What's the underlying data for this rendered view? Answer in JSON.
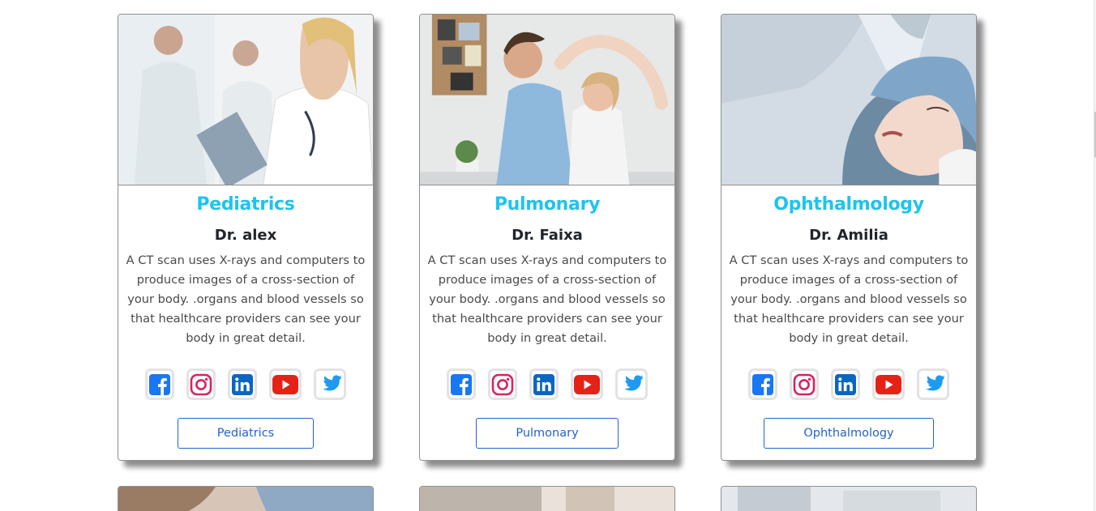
{
  "cards": [
    {
      "department": "Pediatrics",
      "doctor": "Dr. alex",
      "description": "A CT scan uses X-rays and computers to produce images of a cross-section of your body. .organs and blood vessels so that healthcare providers can see your body in great detail.",
      "button_label": "Pediatrics",
      "image_subject": "doctors-photo"
    },
    {
      "department": "Pulmonary",
      "doctor": "Dr. Faixa",
      "description": "A CT scan uses X-rays and computers to produce images of a cross-section of your body. .organs and blood vessels so that healthcare providers can see your body in great detail.",
      "button_label": "Pulmonary",
      "image_subject": "therapist-photo"
    },
    {
      "department": "Ophthalmology",
      "doctor": "Dr. Amilia",
      "description": "A CT scan uses X-rays and computers to produce images of a cross-section of your body. .organs and blood vessels so that healthcare providers can see your body in great detail.",
      "button_label": "Ophthalmology",
      "image_subject": "eye-exam-photo"
    }
  ],
  "social_icons": [
    "facebook-icon",
    "instagram-icon",
    "linkedin-icon",
    "youtube-icon",
    "twitter-icon"
  ],
  "colors": {
    "department_title": "#1ec3f0",
    "button": "#1f63d1",
    "facebook": "#1877f2",
    "instagram": "#d6245f",
    "linkedin": "#0a66c2",
    "youtube": "#e62117",
    "twitter": "#1d9bf0"
  }
}
